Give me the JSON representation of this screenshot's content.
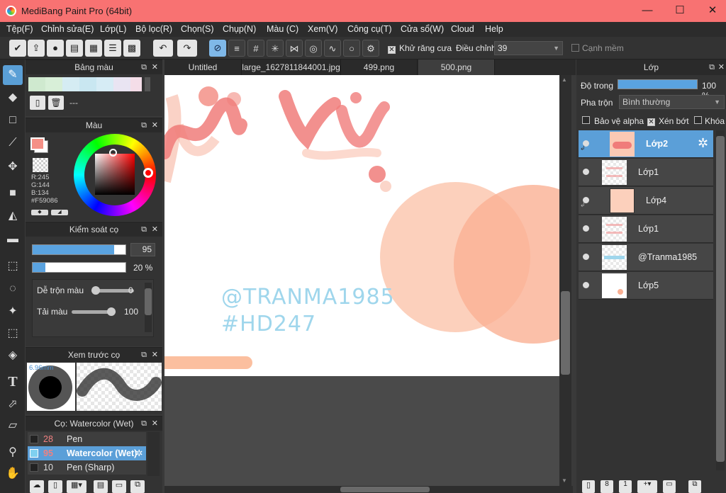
{
  "window": {
    "title": "MediBang Paint Pro (64bit)",
    "min": "—",
    "max": "☐",
    "close": "✕"
  },
  "menu": [
    "Tệp(F)",
    "Chỉnh sửa(E)",
    "Lớp(L)",
    "Bộ lọc(R)",
    "Chọn(S)",
    "Chụp(N)",
    "Màu (C)",
    "Xem(V)",
    "Công cụ(T)",
    "Cửa sổ(W)",
    "Cloud",
    "Help"
  ],
  "toolbar": {
    "antialias_label": "Khử răng cưa",
    "adjust_label": "Điều chỉnh",
    "adjust_value": "39",
    "soft_edge_label": "Cạnh mềm"
  },
  "palette": {
    "title": "Bảng màu",
    "menu_label": "---"
  },
  "color": {
    "title": "Màu",
    "r": "R:245",
    "g": "G:144",
    "b": "B:134",
    "hex": "#F59086",
    "fg": "#f59086"
  },
  "brush_control": {
    "title": "Kiểm soát cọ",
    "size": "95",
    "size_fill": 0.88,
    "opacity": "20 %",
    "opacity_fill": 0.14,
    "mix_label": "Dễ trộn màu",
    "mix_value": "0",
    "mix_fill": 0.0,
    "amount_label": "Tải màu",
    "amount_value": "100",
    "amount_fill": 1.0
  },
  "brush_preview": {
    "title": "Xem trước cọ",
    "size_text": "6.96mm"
  },
  "brush_list": {
    "title": "Cọ: Watercolor (Wet)",
    "items": [
      {
        "size": "28",
        "name": "Pen"
      },
      {
        "size": "95",
        "name": "Watercolor (Wet)"
      },
      {
        "size": "10",
        "name": "Pen (Sharp)"
      }
    ]
  },
  "tabs": [
    "Untitled",
    "large_1627811844001.jpg",
    "499.png",
    "500.png"
  ],
  "canvas_text": {
    "handle": "@TRANMA1985",
    "tag": "#HD247",
    "script": "ú vị"
  },
  "layers_panel": {
    "title": "Lớp",
    "opacity_label": "Độ trong",
    "opacity_value": "100 %",
    "blend_label": "Pha trộn",
    "blend_value": "Bình thường",
    "protect_alpha": "Bảo vệ alpha",
    "clipping": "Xén bớt",
    "lock": "Khóa"
  },
  "layers": [
    {
      "name": "Lớp2"
    },
    {
      "name": "Lớp1"
    },
    {
      "name": "Lớp4"
    },
    {
      "name": "Lớp1"
    },
    {
      "name": "@Tranma1985"
    },
    {
      "name": "Lớp5"
    }
  ]
}
